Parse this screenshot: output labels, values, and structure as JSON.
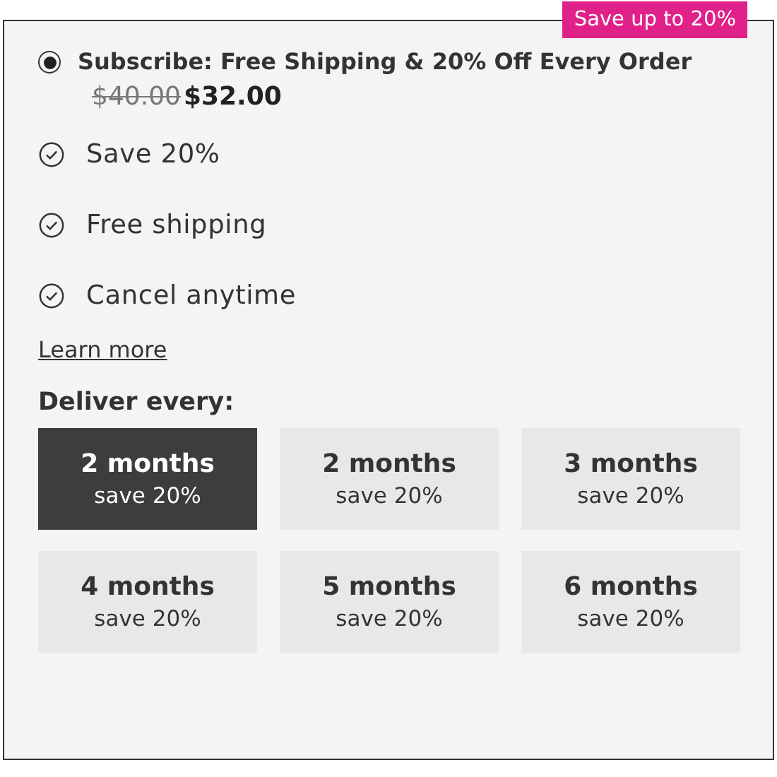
{
  "badge": "Save up to 20%",
  "option": {
    "label": "Subscribe: Free Shipping & 20% Off Every Order",
    "selected": true,
    "original_price": "$40.00",
    "price": "$32.00"
  },
  "benefits": [
    "Save 20%",
    "Free shipping",
    "Cancel anytime"
  ],
  "learn_more": "Learn more",
  "deliver_label": "Deliver every:",
  "frequencies": [
    {
      "title": "2 months",
      "subtitle": "save 20%",
      "selected": true
    },
    {
      "title": "2 months",
      "subtitle": "save 20%",
      "selected": false
    },
    {
      "title": "3 months",
      "subtitle": "save 20%",
      "selected": false
    },
    {
      "title": "4 months",
      "subtitle": "save 20%",
      "selected": false
    },
    {
      "title": "5 months",
      "subtitle": "save 20%",
      "selected": false
    },
    {
      "title": "6 months",
      "subtitle": "save 20%",
      "selected": false
    }
  ]
}
